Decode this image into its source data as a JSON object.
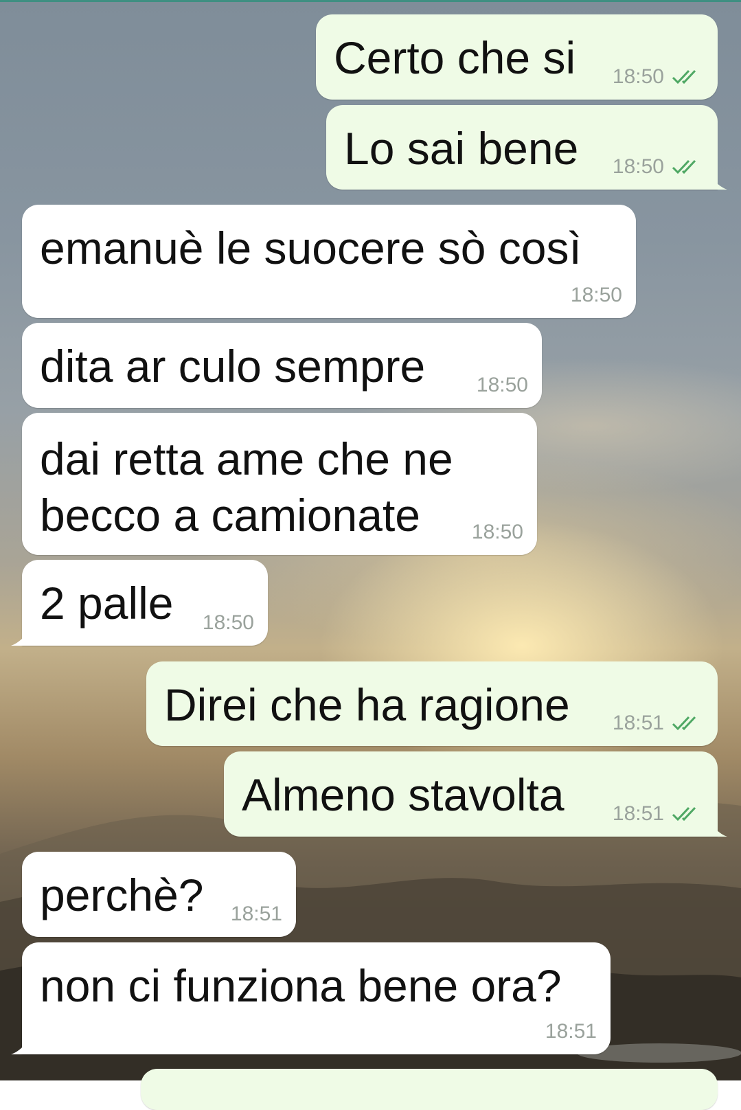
{
  "colors": {
    "outgoing_bubble": "#effbe6",
    "incoming_bubble": "#ffffff",
    "timestamp": "#9aa29c",
    "read_ticks": "#4fa864",
    "top_accent": "#3f8f82"
  },
  "messages": [
    {
      "id": "m1",
      "direction": "outgoing",
      "text": "Certo che si",
      "time": "18:50",
      "status": "read-double-check-icon"
    },
    {
      "id": "m2",
      "direction": "outgoing",
      "text": "Lo sai bene",
      "time": "18:50",
      "status": "read-double-check-icon"
    },
    {
      "id": "m3",
      "direction": "incoming",
      "text": "emanuè le suocere sò così",
      "time": "18:50"
    },
    {
      "id": "m4",
      "direction": "incoming",
      "text": "dita ar culo sempre",
      "time": "18:50"
    },
    {
      "id": "m5",
      "direction": "incoming",
      "text": "dai retta ame che ne becco a camionate",
      "time": "18:50"
    },
    {
      "id": "m6",
      "direction": "incoming",
      "text": "2 palle",
      "time": "18:50"
    },
    {
      "id": "m7",
      "direction": "outgoing",
      "text": "Direi che ha ragione",
      "time": "18:51",
      "status": "read-double-check-icon"
    },
    {
      "id": "m8",
      "direction": "outgoing",
      "text": "Almeno stavolta",
      "time": "18:51",
      "status": "read-double-check-icon"
    },
    {
      "id": "m9",
      "direction": "incoming",
      "text": "perchè?",
      "time": "18:51"
    },
    {
      "id": "m10",
      "direction": "incoming",
      "text": "non ci funziona bene ora?",
      "time": "18:51"
    }
  ]
}
